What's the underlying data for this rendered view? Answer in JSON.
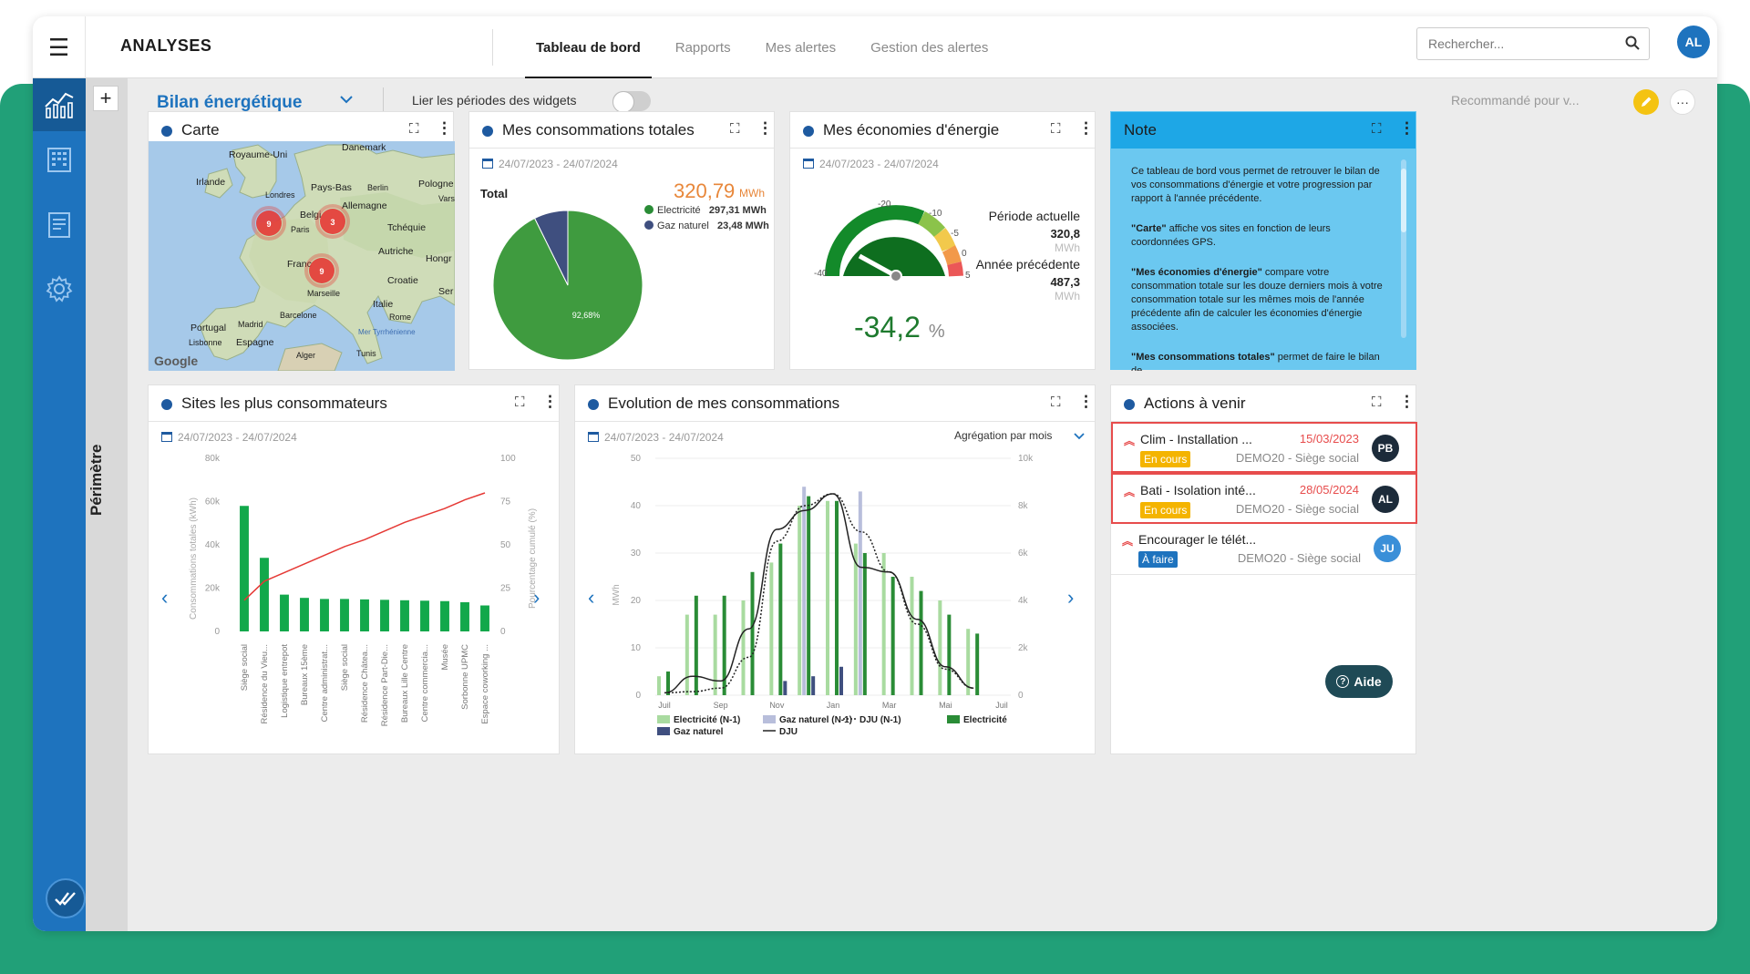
{
  "header": {
    "app_title": "ANALYSES",
    "tabs": [
      {
        "label": "Tableau de bord",
        "active": true
      },
      {
        "label": "Rapports",
        "active": false
      },
      {
        "label": "Mes alertes",
        "active": false
      },
      {
        "label": "Gestion des alertes",
        "active": false
      }
    ],
    "search_placeholder": "Rechercher...",
    "user_initials": "AL"
  },
  "sidebar": {
    "items": [
      "analytics-icon",
      "building-icon",
      "document-icon",
      "settings-icon"
    ],
    "bottom_icon": "check-all-icon"
  },
  "perimetre": {
    "label": "Périmètre",
    "add_symbol": "+"
  },
  "toolbar": {
    "dashboard_title": "Bilan énergétique",
    "link_periods_label": "Lier les périodes des widgets",
    "link_periods_on": false,
    "recommended_label": "Recommandé pour v..."
  },
  "colors": {
    "brand_blue": "#1e73be",
    "electricity": "#2a8c36",
    "gas": "#3f4f7f",
    "danger": "#e74c4c",
    "note": "#6bc8f0"
  },
  "map_widget": {
    "title": "Carte",
    "labels": [
      {
        "text": "Danemark"
      },
      {
        "text": "Royaume-Uni"
      },
      {
        "text": "Irlande"
      },
      {
        "text": "Pays-Bas"
      },
      {
        "text": "Berlin"
      },
      {
        "text": "Pologne"
      },
      {
        "text": "Londres"
      },
      {
        "text": "Belgi"
      },
      {
        "text": "Allemagne"
      },
      {
        "text": "Varsovie"
      },
      {
        "text": "Paris"
      },
      {
        "text": "Tchéquie"
      },
      {
        "text": "Autriche"
      },
      {
        "text": "Franc"
      },
      {
        "text": "Hongr"
      },
      {
        "text": "Croatie"
      },
      {
        "text": "Marseille"
      },
      {
        "text": "Ser"
      },
      {
        "text": "Italie"
      },
      {
        "text": "Barcelone"
      },
      {
        "text": "Rome"
      },
      {
        "text": "Portugal"
      },
      {
        "text": "Madrid"
      },
      {
        "text": "Mer Tyrrhénienne"
      },
      {
        "text": "Lisbonne"
      },
      {
        "text": "Espagne"
      },
      {
        "text": "Alger"
      },
      {
        "text": "Tunis"
      }
    ],
    "clusters": [
      {
        "count": "9"
      },
      {
        "count": "3"
      },
      {
        "count": "9"
      }
    ],
    "attribution": "Google"
  },
  "consumption_widget": {
    "title": "Mes consommations totales",
    "period": "24/07/2023 - 24/07/2024",
    "total_label": "Total",
    "total_value": "320,79",
    "total_unit": "MWh",
    "slice_label": "92,68%",
    "legend": [
      {
        "name": "Electricité",
        "value": "297,31 MWh",
        "color": "#2a8c36"
      },
      {
        "name": "Gaz naturel",
        "value": "23,48 MWh",
        "color": "#3f4f7f"
      }
    ]
  },
  "savings_widget": {
    "title": "Mes économies d'énergie",
    "period": "24/07/2023 - 24/07/2024",
    "gauge_ticks": [
      "-40",
      "-20",
      "-10",
      "-5",
      "0",
      "5"
    ],
    "current_label": "Période actuelle",
    "current_value": "320,8",
    "current_unit": "MWh",
    "previous_label": "Année précédente",
    "previous_value": "487,3",
    "previous_unit": "MWh",
    "savings_value": "-34,2",
    "savings_unit": "%"
  },
  "note_widget": {
    "title": "Note",
    "p1": "Ce tableau de bord vous permet de retrouver le bilan de vos consommations d'énergie et votre progression par rapport à l'année précédente.",
    "p2_bold": "\"Carte\"",
    "p2_rest": " affiche vos sites en fonction de leurs coordonnées GPS.",
    "p3_bold": "\"Mes économies d'énergie\"",
    "p3_rest": " compare votre consommation totale sur les douze derniers mois à votre consommation totale sur les mêmes mois de l'année précédente afin de calculer les économies d'énergie associées.",
    "p4_bold": "\"Mes consommations totales\"",
    "p4_rest": " permet de faire le bilan de"
  },
  "sites_widget": {
    "title": "Sites les plus consommateurs",
    "period": "24/07/2023 - 24/07/2024",
    "left_axis_label": "Consommations totales (kWh)",
    "right_axis_label": "Pourcentage cumulé (%)"
  },
  "evolution_widget": {
    "title": "Evolution de mes consommations",
    "period": "24/07/2023 - 24/07/2024",
    "aggregation_label": "Agrégation par mois",
    "left_axis_label": "MWh",
    "legend": [
      {
        "name": "Electricité (N-1)",
        "kind": "bar",
        "color": "#a9dba0"
      },
      {
        "name": "Gaz naturel (N-1)",
        "kind": "bar",
        "color": "#b8bedb"
      },
      {
        "name": "DJU (N-1)",
        "kind": "dotted",
        "color": "#222222"
      },
      {
        "name": "Electricité",
        "kind": "bar",
        "color": "#2a8c36"
      },
      {
        "name": "Gaz naturel",
        "kind": "bar",
        "color": "#3f4f7f"
      },
      {
        "name": "DJU",
        "kind": "line",
        "color": "#222222"
      }
    ]
  },
  "actions_widget": {
    "title": "Actions à venir",
    "items": [
      {
        "title": "Clim - Installation ...",
        "date": "15/03/2023",
        "status": "En cours",
        "status_color": "#f4b400",
        "site": "DEMO20 - Siège social",
        "initials": "PB",
        "avatar_color": "#1c2b3a",
        "highlighted": true
      },
      {
        "title": "Bati - Isolation inté...",
        "date": "28/05/2024",
        "status": "En cours",
        "status_color": "#f4b400",
        "site": "DEMO20 - Siège social",
        "initials": "AL",
        "avatar_color": "#1c2b3a",
        "highlighted": true
      },
      {
        "title": "Encourager le télét...",
        "date": "",
        "status": "À faire",
        "status_color": "#1e73be",
        "site": "DEMO20 - Siège social",
        "initials": "JU",
        "avatar_color": "#3a8fd8",
        "highlighted": false
      }
    ]
  },
  "help_button": {
    "label": "Aide"
  },
  "chart_data": [
    {
      "type": "pie",
      "title": "Mes consommations totales",
      "categories": [
        "Electricité",
        "Gaz naturel"
      ],
      "values": [
        297.31,
        23.48
      ],
      "unit": "MWh"
    },
    {
      "type": "bar",
      "title": "Sites les plus consommateurs",
      "categories": [
        "Siège social",
        "Résidence du Vieu...",
        "Logistique entrepot",
        "Bureaux 15ème",
        "Centre administrat...",
        "Siège social",
        "Résidence Châtea...",
        "Résidence Part-Die...",
        "Bureaux Lille Centre",
        "Centre commercia...",
        "Musée",
        "Sorbonne UPMC",
        "Espace coworking ..."
      ],
      "values": [
        58000,
        34000,
        17000,
        15500,
        15000,
        15000,
        14800,
        14600,
        14400,
        14200,
        14000,
        13500,
        12000
      ],
      "cumulative_percent": [
        18,
        29,
        34,
        39,
        44,
        49,
        53,
        58,
        63,
        67,
        71,
        76,
        80
      ],
      "ylim": [
        0,
        80000
      ],
      "y2lim": [
        0,
        100
      ],
      "y_ticks": [
        "0",
        "20k",
        "40k",
        "60k",
        "80k"
      ],
      "y2_ticks": [
        "0",
        "25",
        "50",
        "75",
        "100"
      ]
    },
    {
      "type": "bar",
      "title": "Evolution de mes consommations",
      "categories": [
        "Juil",
        "Août",
        "Sep",
        "Oct",
        "Nov",
        "Déc",
        "Jan",
        "Fév",
        "Mar",
        "Avr",
        "Mai",
        "Juin",
        "Juil"
      ],
      "x_tick_labels": [
        "Juil",
        "",
        "Sep",
        "",
        "Nov",
        "",
        "Jan",
        "",
        "Mar",
        "",
        "Mai",
        "",
        "Juil"
      ],
      "ylim": [
        0,
        50
      ],
      "y2lim": [
        0,
        10000
      ],
      "y_ticks": [
        "0",
        "10",
        "20",
        "30",
        "40",
        "50"
      ],
      "y2_ticks": [
        "0",
        "2k",
        "4k",
        "6k",
        "8k",
        "10k"
      ],
      "series": [
        {
          "name": "Electricité (N-1)",
          "values": [
            4,
            17,
            17,
            20,
            28,
            40,
            41,
            32,
            30,
            25,
            20,
            14,
            0
          ]
        },
        {
          "name": "Gaz naturel (N-1)",
          "values": [
            0,
            0,
            0,
            0,
            0,
            44,
            0,
            43,
            0,
            0,
            0,
            0,
            0
          ]
        },
        {
          "name": "Electricité",
          "values": [
            5,
            21,
            21,
            26,
            32,
            42,
            41,
            30,
            25,
            22,
            17,
            13,
            0
          ]
        },
        {
          "name": "Gaz naturel",
          "values": [
            0,
            0,
            0,
            0,
            3,
            4,
            6,
            0,
            0,
            0,
            0,
            0,
            0
          ]
        },
        {
          "name": "DJU (N-1)",
          "values": [
            100,
            150,
            300,
            1600,
            6500,
            8000,
            8500,
            6900,
            5200,
            3000,
            1100,
            300,
            0
          ]
        },
        {
          "name": "DJU",
          "values": [
            100,
            800,
            600,
            2800,
            7000,
            7800,
            8500,
            5400,
            5200,
            3200,
            1200,
            300,
            0
          ]
        }
      ]
    }
  ]
}
